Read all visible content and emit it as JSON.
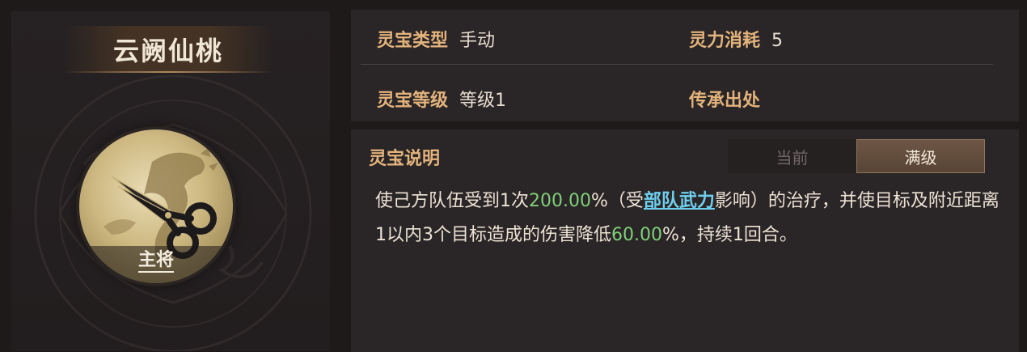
{
  "treasure": {
    "name": "云阙仙桃",
    "role_label": "主将"
  },
  "info": {
    "type_label": "灵宝类型",
    "type_value": "手动",
    "cost_label": "灵力消耗",
    "cost_value": "5",
    "level_label": "灵宝等级",
    "level_value": "等级1",
    "origin_label": "传承出处",
    "origin_value": ""
  },
  "description": {
    "title": "灵宝说明",
    "tabs": {
      "current": "当前",
      "max": "满级"
    },
    "active_tab": "max",
    "seg1": "使己方队伍受到1次",
    "heal_value": "200.00",
    "seg2": "%（受",
    "link_text": "部队武力",
    "seg3": "影响）的治疗，并使目标及附近距离1以内3个目标造成的伤害降低",
    "reduce_value": "60.00",
    "seg4": "%，持续1回合。"
  },
  "colors": {
    "label_gold": "#e2b37c",
    "highlight_green": "#7fd07a",
    "link_cyan": "#6ed0ef"
  },
  "icons": {
    "emblem": "scissors-dragon-icon"
  }
}
